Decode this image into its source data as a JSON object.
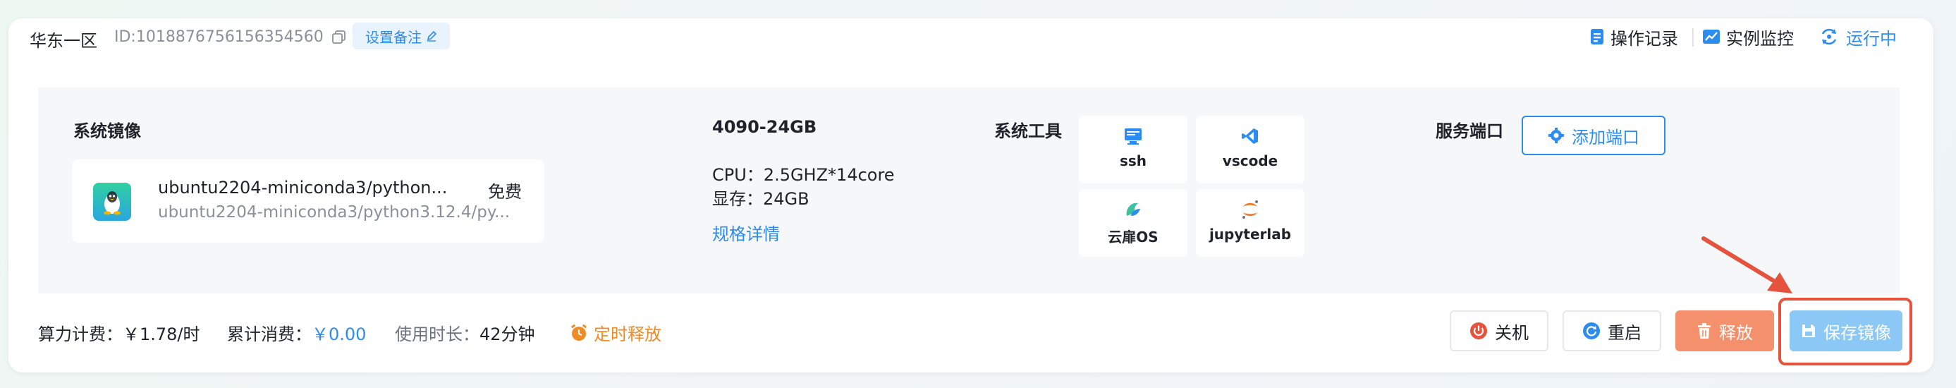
{
  "header": {
    "region": "华东一区",
    "instance_id": "ID:1018876756156354560",
    "remark_button": "设置备注",
    "op_log": "操作记录",
    "monitor": "实例监控",
    "status": "运行中"
  },
  "image_section": {
    "title": "系统镜像",
    "name": "ubuntu2204-miniconda3/python...",
    "full_name": "ubuntu2204-miniconda3/python3.12.4/py...",
    "price": "免费"
  },
  "spec": {
    "gpu": "4090-24GB",
    "cpu": "CPU：2.5GHZ*14core",
    "memory": "显存：24GB",
    "details_link": "规格详情"
  },
  "tools": {
    "title": "系统工具",
    "items": [
      {
        "label": "ssh",
        "icon": "ssh-icon"
      },
      {
        "label": "vscode",
        "icon": "vscode-icon"
      },
      {
        "label": "云扉OS",
        "icon": "yunfei-os-icon"
      },
      {
        "label": "jupyterlab",
        "icon": "jupyter-icon"
      }
    ]
  },
  "ports": {
    "title": "服务端口",
    "add_button": "添加端口"
  },
  "footer": {
    "rate_label": "算力计费：",
    "rate_value": "￥1.78/时",
    "total_label": "累计消费：",
    "total_value": "￥0.00",
    "duration_label": "使用时长：",
    "duration_value": "42分钟",
    "schedule_release": "定时释放"
  },
  "actions": {
    "shutdown": "关机",
    "restart": "重启",
    "release": "释放",
    "save_image": "保存镜像"
  },
  "colors": {
    "accent": "#2d8cf0",
    "release": "#f4906c",
    "save": "#8cc8f5",
    "highlight": "#e5533d"
  }
}
